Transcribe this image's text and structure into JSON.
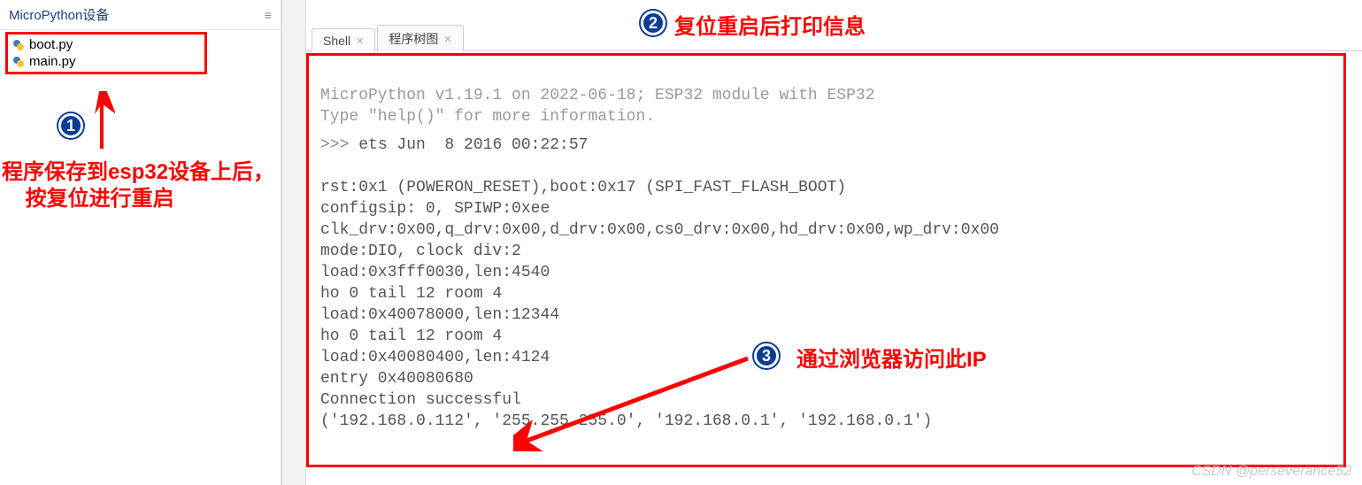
{
  "sidebar": {
    "title": "MicroPython设备",
    "files": [
      {
        "name": "boot.py"
      },
      {
        "name": "main.py"
      }
    ]
  },
  "tabs": [
    {
      "label": "Shell",
      "active": true
    },
    {
      "label": "程序树图",
      "active": false
    }
  ],
  "shell": {
    "line1": "MicroPython v1.19.1 on 2022-06-18; ESP32 module with ESP32",
    "line2": "Type \"help()\" for more information.",
    "prompt": ">>> ",
    "promptText": "ets Jun  8 2016 00:22:57",
    "body": "rst:0x1 (POWERON_RESET),boot:0x17 (SPI_FAST_FLASH_BOOT)\nconfigsip: 0, SPIWP:0xee\nclk_drv:0x00,q_drv:0x00,d_drv:0x00,cs0_drv:0x00,hd_drv:0x00,wp_drv:0x00\nmode:DIO, clock div:2\nload:0x3fff0030,len:4540\nho 0 tail 12 room 4\nload:0x40078000,len:12344\nho 0 tail 12 room 4\nload:0x40080400,len:4124\nentry 0x40080680\nConnection successful\n('192.168.0.112', '255.255.255.0', '192.168.0.1', '192.168.0.1')"
  },
  "annotations": {
    "a1": "程序保存到esp32设备上后，\n    按复位进行重启",
    "a2": "复位重启后打印信息",
    "a3": "通过浏览器访问此IP"
  },
  "badges": {
    "b1": "1",
    "b2": "2",
    "b3": "3"
  },
  "watermark": "CSDN @perseverance52"
}
